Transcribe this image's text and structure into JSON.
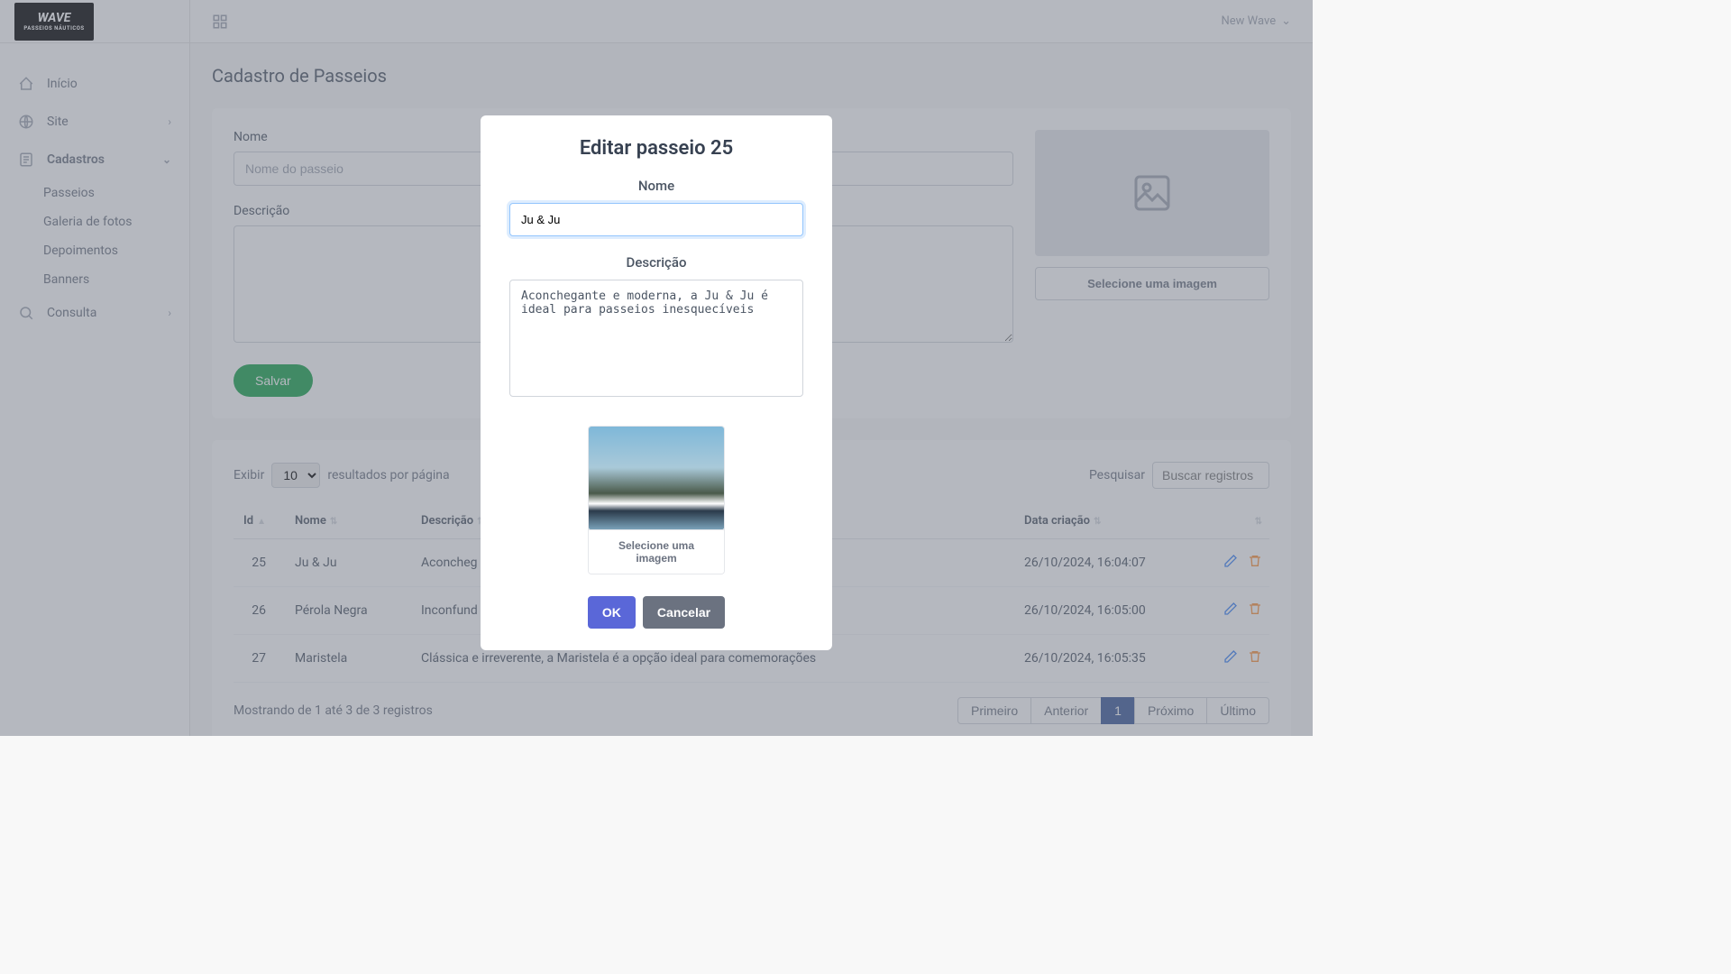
{
  "brand": {
    "top": "WAVE",
    "bottom": "PASSEIOS NÁUTICOS"
  },
  "topbar": {
    "user": "New Wave"
  },
  "sidebar": {
    "items": [
      {
        "label": "Início",
        "icon": "home"
      },
      {
        "label": "Site",
        "icon": "globe",
        "chevron": "right"
      },
      {
        "label": "Cadastros",
        "icon": "form",
        "chevron": "down",
        "active": true,
        "children": [
          {
            "label": "Passeios"
          },
          {
            "label": "Galeria de fotos"
          },
          {
            "label": "Depoimentos"
          },
          {
            "label": "Banners"
          }
        ]
      },
      {
        "label": "Consulta",
        "icon": "search",
        "chevron": "right"
      }
    ]
  },
  "page": {
    "title": "Cadastro de Passeios"
  },
  "form": {
    "nome_label": "Nome",
    "nome_placeholder": "Nome do passeio",
    "desc_label": "Descrição",
    "select_image_label": "Selecione uma imagem",
    "save_label": "Salvar"
  },
  "table": {
    "show_label": "Exibir",
    "page_size": "10",
    "per_page_label": "resultados por página",
    "search_label": "Pesquisar",
    "search_placeholder": "Buscar registros",
    "headers": {
      "id": "Id",
      "nome": "Nome",
      "desc": "Descrição",
      "date": "Data criação"
    },
    "rows": [
      {
        "id": "25",
        "nome": "Ju & Ju",
        "desc": "Aconcheg",
        "date": "26/10/2024, 16:04:07"
      },
      {
        "id": "26",
        "nome": "Pérola Negra",
        "desc": "Inconfund",
        "date": "26/10/2024, 16:05:00"
      },
      {
        "id": "27",
        "nome": "Maristela",
        "desc": "Clássica e irreverente, a Maristela é a opção ideal para comemorações",
        "date": "26/10/2024, 16:05:35"
      }
    ],
    "footer_text": "Mostrando de 1 até 3 de 3 registros",
    "pagination": {
      "first": "Primeiro",
      "prev": "Anterior",
      "page": "1",
      "next": "Próximo",
      "last": "Último"
    }
  },
  "modal": {
    "title": "Editar passeio 25",
    "nome_label": "Nome",
    "nome_value": "Ju & Ju",
    "desc_label": "Descrição",
    "desc_value": "Aconchegante e moderna, a Ju & Ju é ideal para passeios inesquecíveis",
    "select_image_label": "Selecione uma imagem",
    "ok": "OK",
    "cancel": "Cancelar"
  }
}
